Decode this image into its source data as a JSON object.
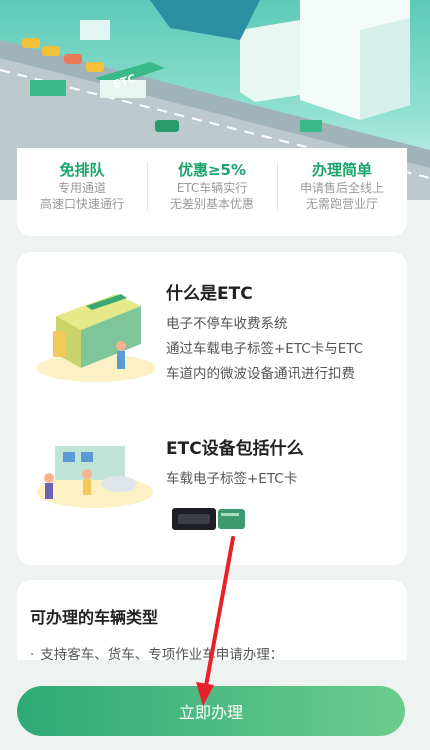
{
  "hero": {
    "etc_sign": "ETC"
  },
  "features": [
    {
      "title": "免排队",
      "line1": "专用通道",
      "line2": "高速口快速通行"
    },
    {
      "title": "优惠≥5%",
      "line1": "ETC车辆实行",
      "line2": "无差别基本优惠"
    },
    {
      "title": "办理简单",
      "line1": "申请售后全线上",
      "line2": "无需跑营业厅"
    }
  ],
  "what_is": {
    "title": "什么是ETC",
    "lines": [
      "电子不停车收费系统",
      "通过车载电子标签+ETC卡与ETC",
      "车道内的微波设备通讯进行扣费"
    ]
  },
  "includes": {
    "title": "ETC设备包括什么",
    "lines": [
      "车载电子标签+ETC卡"
    ]
  },
  "vehicles": {
    "title": "可办理的车辆类型",
    "bullet": "·",
    "item": "支持客车、货车、专项作业车申请办理："
  },
  "button": {
    "label": "立即办理"
  },
  "colors": {
    "accent": "#1aa36b",
    "button_start": "#2fa978",
    "button_end": "#6ccc8c",
    "annotation": "#e8202a"
  }
}
